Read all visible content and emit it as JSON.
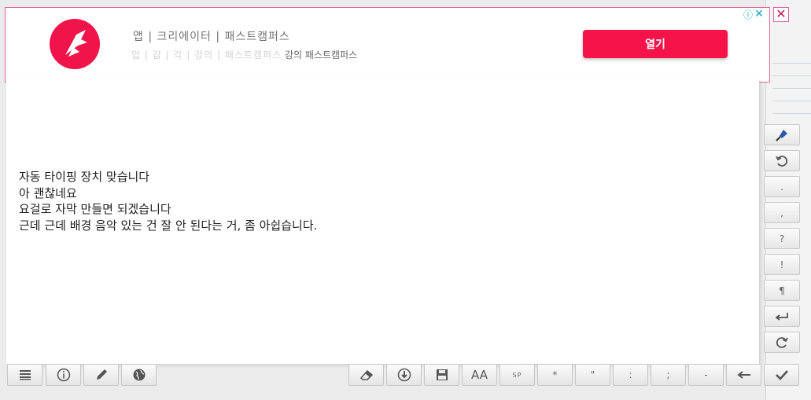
{
  "ad": {
    "headline": "앱 | 크리에이터 | 패스트캠퍼스",
    "subline_partial": "업 | 감 | 각 | 강의 | 패스트캠퍼스",
    "subline_visible": "강의 패스트캠퍼스",
    "open_label": "열기",
    "info_icon": "ⓘ",
    "x_icon": "✕",
    "close_icon": "✕",
    "brand_color": "#f5134a"
  },
  "transcript": {
    "lines": [
      "자동 타이핑 장치 맞습니다",
      "아 괜찮네요",
      "요걸로 자막 만들면 되겠습니다",
      "근데 근데 배경 음악 있는 건 잘 안 된다는 거, 좀 아쉽습니다."
    ]
  },
  "side_toolbar": {
    "buttons": [
      {
        "name": "microphone-icon"
      },
      {
        "name": "undo-icon"
      },
      {
        "name": "period-button",
        "label": "."
      },
      {
        "name": "comma-button",
        "label": ","
      },
      {
        "name": "question-button",
        "label": "?"
      },
      {
        "name": "exclamation-button",
        "label": "!"
      },
      {
        "name": "paragraph-button",
        "label": "¶"
      },
      {
        "name": "enter-icon"
      },
      {
        "name": "redo-icon"
      }
    ]
  },
  "bottom_toolbar": {
    "left": [
      {
        "name": "menu-icon"
      },
      {
        "name": "info-icon"
      },
      {
        "name": "pencil-icon"
      },
      {
        "name": "globe-icon"
      }
    ],
    "right": [
      {
        "name": "eraser-icon"
      },
      {
        "name": "download-icon"
      },
      {
        "name": "save-icon"
      },
      {
        "name": "font-size-icon",
        "label": "AA"
      },
      {
        "name": "space-button",
        "label": "SP"
      },
      {
        "name": "asterisk-button",
        "label": "*"
      },
      {
        "name": "quote-button",
        "label": "\""
      },
      {
        "name": "colon-button",
        "label": ":"
      },
      {
        "name": "semicolon-button",
        "label": ";"
      },
      {
        "name": "dash-button",
        "label": "-"
      },
      {
        "name": "backspace-icon"
      },
      {
        "name": "confirm-icon"
      }
    ]
  }
}
